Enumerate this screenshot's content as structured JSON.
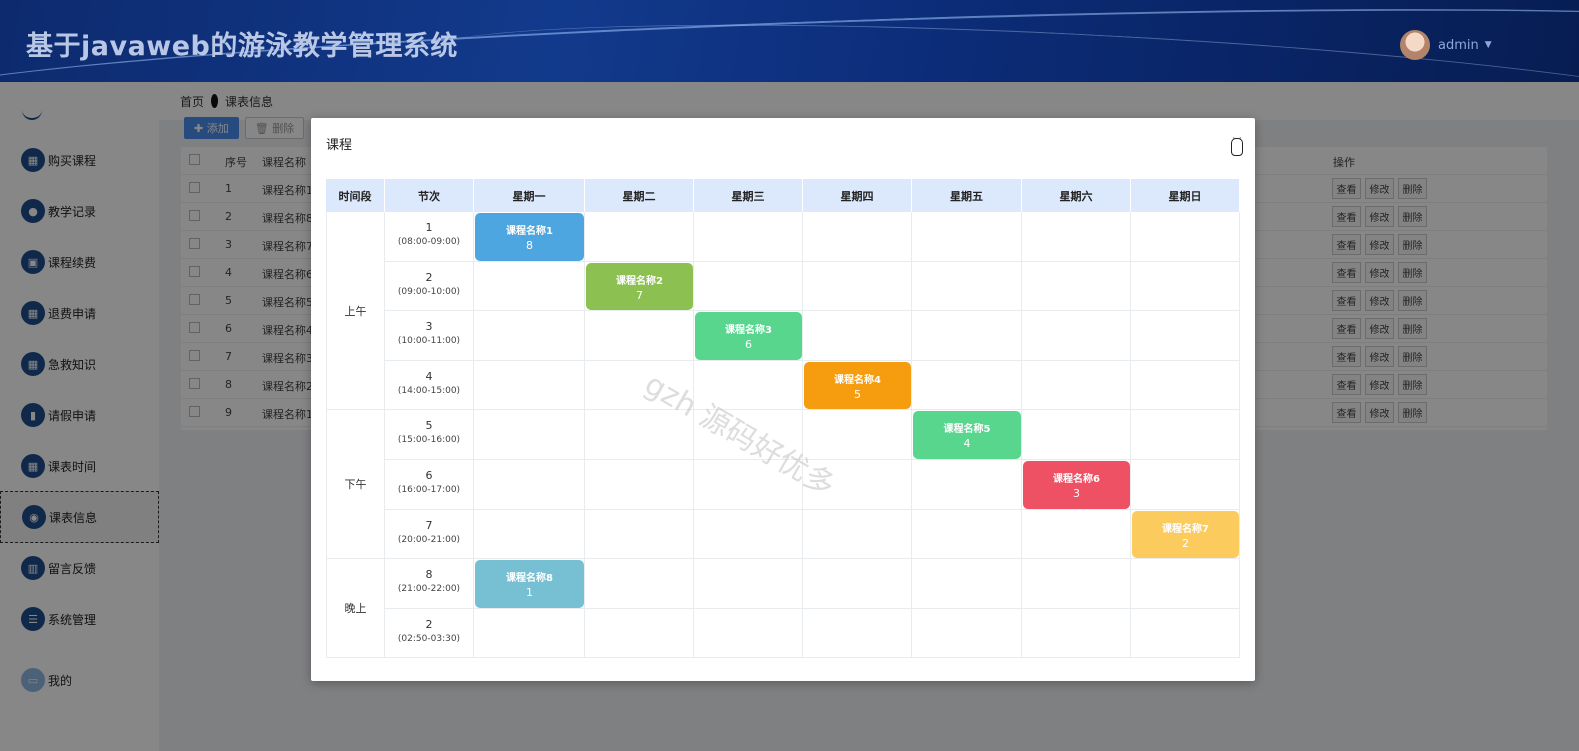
{
  "app": {
    "title": "基于javaweb的游泳教学管理系统",
    "user": "admin"
  },
  "sidebar": {
    "items": [
      {
        "label": "购买课程",
        "icon": "grid-icon"
      },
      {
        "label": "教学记录",
        "icon": "user-icon"
      },
      {
        "label": "课程续费",
        "icon": "chart-icon"
      },
      {
        "label": "退费申请",
        "icon": "grid-icon"
      },
      {
        "label": "急救知识",
        "icon": "grid-icon"
      },
      {
        "label": "请假申请",
        "icon": "bar-chart-icon"
      },
      {
        "label": "课表时间",
        "icon": "grid-icon"
      },
      {
        "label": "课表信息",
        "icon": "location-icon"
      },
      {
        "label": "留言反馈",
        "icon": "bars-icon"
      },
      {
        "label": "系统管理",
        "icon": "list-icon"
      },
      {
        "label": "我的",
        "icon": "window-icon"
      }
    ],
    "active": "课表信息"
  },
  "breadcrumb": {
    "home": "首页",
    "current": "课表信息"
  },
  "toolbar": {
    "add": "添加",
    "delete": "删除"
  },
  "table": {
    "headers": {
      "index": "序号",
      "name": "课程名称",
      "actions": "操作"
    },
    "rows": [
      {
        "index": "1",
        "name": "课程名称1"
      },
      {
        "index": "2",
        "name": "课程名称8"
      },
      {
        "index": "3",
        "name": "课程名称7"
      },
      {
        "index": "4",
        "name": "课程名称6"
      },
      {
        "index": "5",
        "name": "课程名称5"
      },
      {
        "index": "6",
        "name": "课程名称4"
      },
      {
        "index": "7",
        "name": "课程名称3"
      },
      {
        "index": "8",
        "name": "课程名称2"
      },
      {
        "index": "9",
        "name": "课程名称1"
      }
    ],
    "row_actions": {
      "view": "查看",
      "edit": "修改",
      "delete": "删除"
    }
  },
  "modal": {
    "title": "课程",
    "close": "×",
    "headers": [
      "时间段",
      "节次",
      "星期一",
      "星期二",
      "星期三",
      "星期四",
      "星期五",
      "星期六",
      "星期日"
    ],
    "periods": [
      {
        "label": "上午",
        "rows": 4
      },
      {
        "label": "下午",
        "rows": 3
      },
      {
        "label": "晚上",
        "rows": 2
      }
    ],
    "slots": [
      {
        "num": "1",
        "time": "(08:00-09:00)"
      },
      {
        "num": "2",
        "time": "(09:00-10:00)"
      },
      {
        "num": "3",
        "time": "(10:00-11:00)"
      },
      {
        "num": "4",
        "time": "(14:00-15:00)"
      },
      {
        "num": "5",
        "time": "(15:00-16:00)"
      },
      {
        "num": "6",
        "time": "(16:00-17:00)"
      },
      {
        "num": "7",
        "time": "(20:00-21:00)"
      },
      {
        "num": "8",
        "time": "(21:00-22:00)"
      },
      {
        "num": "2",
        "time": "(02:50-03:30)"
      }
    ],
    "courses": [
      {
        "row": 0,
        "day": 0,
        "name": "课程名称1",
        "count": "8",
        "color": "#4da6e0"
      },
      {
        "row": 1,
        "day": 1,
        "name": "课程名称2",
        "count": "7",
        "color": "#8cc152"
      },
      {
        "row": 2,
        "day": 2,
        "name": "课程名称3",
        "count": "6",
        "color": "#58d68d"
      },
      {
        "row": 3,
        "day": 3,
        "name": "课程名称4",
        "count": "5",
        "color": "#f59c0f"
      },
      {
        "row": 4,
        "day": 4,
        "name": "课程名称5",
        "count": "4",
        "color": "#58d68d"
      },
      {
        "row": 5,
        "day": 5,
        "name": "课程名称6",
        "count": "3",
        "color": "#ee5064"
      },
      {
        "row": 6,
        "day": 6,
        "name": "课程名称7",
        "count": "2",
        "color": "#fccb5e"
      },
      {
        "row": 7,
        "day": 0,
        "name": "课程名称8",
        "count": "1",
        "color": "#77bfd2"
      }
    ]
  },
  "watermark": "gzh 源码好优多"
}
